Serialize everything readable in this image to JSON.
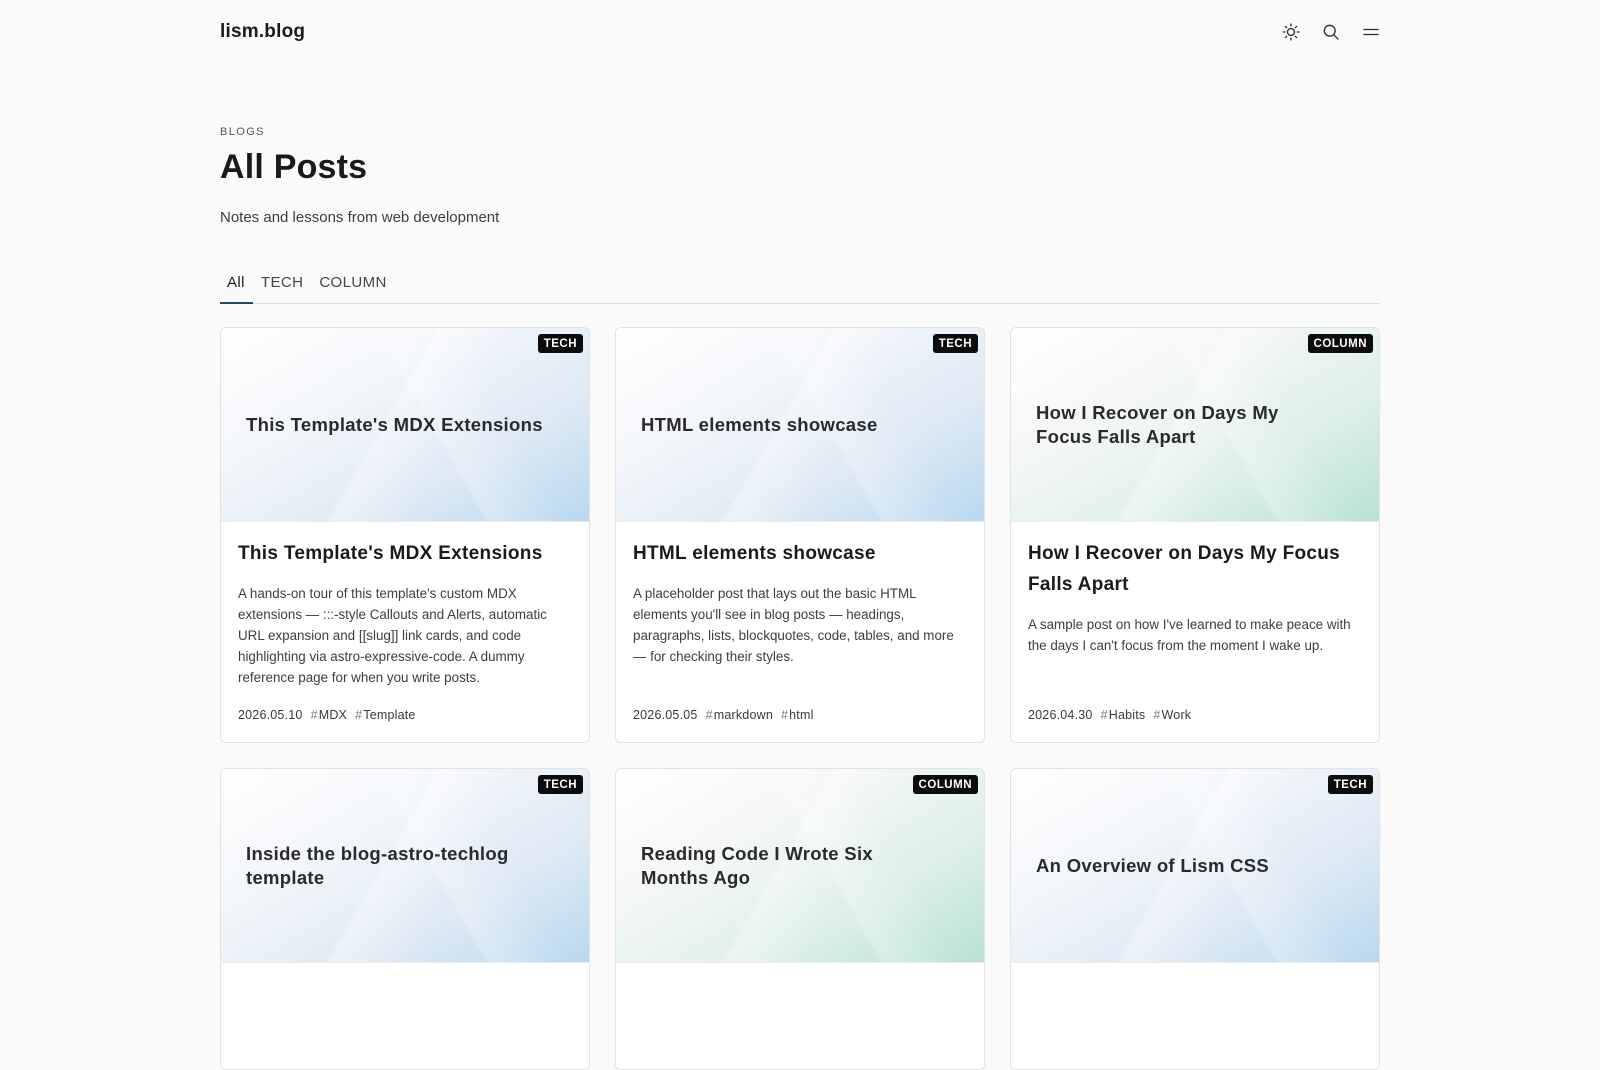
{
  "header": {
    "logo": "lism.blog"
  },
  "icons": {
    "theme": "sun-icon",
    "search": "search-icon",
    "menu": "menu-icon"
  },
  "page": {
    "eyebrow": "BLOGS",
    "title": "All Posts",
    "description": "Notes and lessons from web development"
  },
  "tabs": [
    {
      "label": "All",
      "active": true
    },
    {
      "label": "TECH",
      "active": false
    },
    {
      "label": "COLUMN",
      "active": false
    }
  ],
  "colors": {
    "accent": "#1e4b5e",
    "badge_bg": "#0c0c0c"
  },
  "posts": [
    {
      "category": "TECH",
      "thumb_title": "This Template's MDX Extensions",
      "title": "This Template's MDX Extensions",
      "excerpt": "A hands-on tour of this template's custom MDX extensions — :::-style Callouts and Alerts, automatic URL expansion and [[slug]] link cards, and code highlighting via astro-expressive-code. A dummy reference page for when you write posts.",
      "date": "2026.05.10",
      "tags": [
        "MDX",
        "Template"
      ]
    },
    {
      "category": "TECH",
      "thumb_title": "HTML elements showcase",
      "title": "HTML elements showcase",
      "excerpt": "A placeholder post that lays out the basic HTML elements you'll see in blog posts — headings, paragraphs, lists, blockquotes, code, tables, and more — for checking their styles.",
      "date": "2026.05.05",
      "tags": [
        "markdown",
        "html"
      ]
    },
    {
      "category": "COLUMN",
      "thumb_title": "How I Recover on Days My Focus Falls Apart",
      "title": "How I Recover on Days My Focus Falls Apart",
      "excerpt": "A sample post on how I've learned to make peace with the days I can't focus from the moment I wake up.",
      "date": "2026.04.30",
      "tags": [
        "Habits",
        "Work"
      ]
    },
    {
      "category": "TECH",
      "thumb_title": "Inside the blog-astro-techlog template"
    },
    {
      "category": "COLUMN",
      "thumb_title": "Reading Code I Wrote Six Months Ago"
    },
    {
      "category": "TECH",
      "thumb_title": "An Overview of Lism CSS"
    }
  ]
}
